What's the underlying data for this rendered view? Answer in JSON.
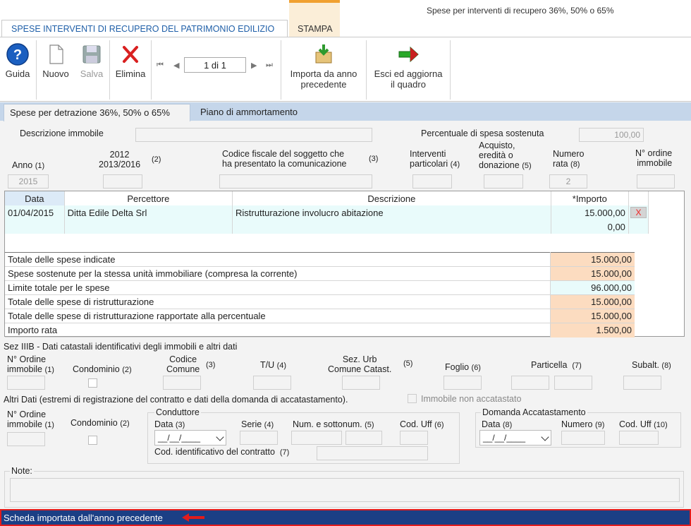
{
  "window": {
    "title": "Spese per interventi di recupero 36%, 50% o 65%"
  },
  "tabs": [
    {
      "label": "SPESE INTERVENTI DI RECUPERO DEL PATRIMONIO EDILIZIO"
    },
    {
      "label": "STAMPA"
    }
  ],
  "toolbar": {
    "guida": "Guida",
    "nuovo": "Nuovo",
    "salva": "Salva",
    "elimina": "Elimina",
    "page_value": "1 di 1",
    "importa": [
      "Importa da anno",
      "precedente"
    ],
    "esci": [
      "Esci ed aggiorna",
      "il quadro"
    ]
  },
  "subtabs": [
    {
      "label": "Spese per detrazione 36%, 50% o 65%"
    },
    {
      "label": "Piano di ammortamento"
    }
  ],
  "form": {
    "descrizione_immobile": "Descrizione immobile",
    "percentuale_label": "Percentuale di spesa sostenuta",
    "percentuale_value": "100,00",
    "anno_label": "Anno",
    "anno_ref": "(1)",
    "anno_value": "2015",
    "y2012": [
      "2012",
      "2013/2016"
    ],
    "y2012_ref": "(2)",
    "codice_fiscale": [
      "Codice fiscale del soggetto che",
      "ha presentato la comunicazione"
    ],
    "codice_fiscale_ref": "(3)",
    "interventi": [
      "Interventi",
      "particolari"
    ],
    "interventi_ref": "(4)",
    "acquisto": [
      "Acquisto,",
      "eredità o",
      "donazione"
    ],
    "acquisto_ref": "(5)",
    "numero_rata": [
      "Numero",
      "rata"
    ],
    "numero_rata_ref": "(8)",
    "numero_rata_value": "2",
    "ordine": [
      "N° ordine",
      "immobile"
    ]
  },
  "grid": {
    "headers": [
      "Data",
      "Percettore",
      "Descrizione",
      "*Importo"
    ],
    "rows": [
      {
        "data": "01/04/2015",
        "percettore": "Ditta Edile Delta Srl",
        "descrizione": "Ristrutturazione involucro abitazione",
        "importo": "15.000,00",
        "delete": "X"
      },
      {
        "data": "",
        "percettore": "",
        "descrizione": "",
        "importo": "0,00",
        "delete": ""
      }
    ]
  },
  "totals": [
    {
      "label": "Totale delle spese indicate",
      "value": "15.000,00"
    },
    {
      "label": "Spese sostenute per la stessa unità immobiliare (compresa la corrente)",
      "value": "15.000,00"
    },
    {
      "label": "Limite totale per le spese",
      "value": "96.000,00"
    },
    {
      "label": "Totale delle spese di ristrutturazione",
      "value": "15.000,00"
    },
    {
      "label": "Totale delle spese di ristrutturazione rapportate alla percentuale",
      "value": "15.000,00"
    },
    {
      "label": "Importo rata",
      "value": "1.500,00"
    }
  ],
  "catasto": {
    "title": "Sez IIIB - Dati catastali identificativi degli immobili e altri dati",
    "ordine": [
      "N° Ordine",
      "immobile"
    ],
    "ordine_ref": "(1)",
    "condominio": "Condominio",
    "condominio_ref": "(2)",
    "codice_comune": [
      "Codice",
      "Comune"
    ],
    "codice_comune_ref": "(3)",
    "tu": "T/U",
    "tu_ref": "(4)",
    "sez_urb": [
      "Sez. Urb",
      "Comune Catast."
    ],
    "sez_urb_ref": "(5)",
    "foglio": "Foglio",
    "foglio_ref": "(6)",
    "particella": "Particella",
    "particella_ref": "(7)",
    "subalt": "Subalt.",
    "subalt_ref": "(8)"
  },
  "altri": {
    "title": "Altri Dati (estremi di registrazione del contratto e dati della domanda di accatastamento).",
    "non_accatastato": "Immobile non accatastato",
    "ordine": [
      "N° Ordine",
      "immobile"
    ],
    "ordine_ref": "(1)",
    "condominio": "Condominio",
    "condominio_ref": "(2)",
    "conduttore": "Conduttore",
    "data": "Data",
    "data_ref": "(3)",
    "data_value": "__/__/____",
    "serie": "Serie",
    "serie_ref": "(4)",
    "num_sottonum": "Num. e sottonum.",
    "num_sottonum_ref": "(5)",
    "cod_uff": "Cod. Uff",
    "cod_uff_ref": "(6)",
    "cod_contratto": "Cod. identificativo del contratto",
    "cod_contratto_ref": "(7)",
    "domanda": "Domanda Accatastamento",
    "d_data": "Data",
    "d_data_ref": "(8)",
    "d_data_value": "__/__/____",
    "d_numero": "Numero",
    "d_numero_ref": "(9)",
    "d_cod_uff": "Cod. Uff",
    "d_cod_uff_ref": "(10)"
  },
  "note_label": "Note:",
  "status": "Scheda importata dall'anno precedente",
  "colors": {
    "tab_active": "#1f5fa8",
    "status_bg": "#1b3f85",
    "highlight": "#e21c1c",
    "orange": "#fcdcc0"
  }
}
